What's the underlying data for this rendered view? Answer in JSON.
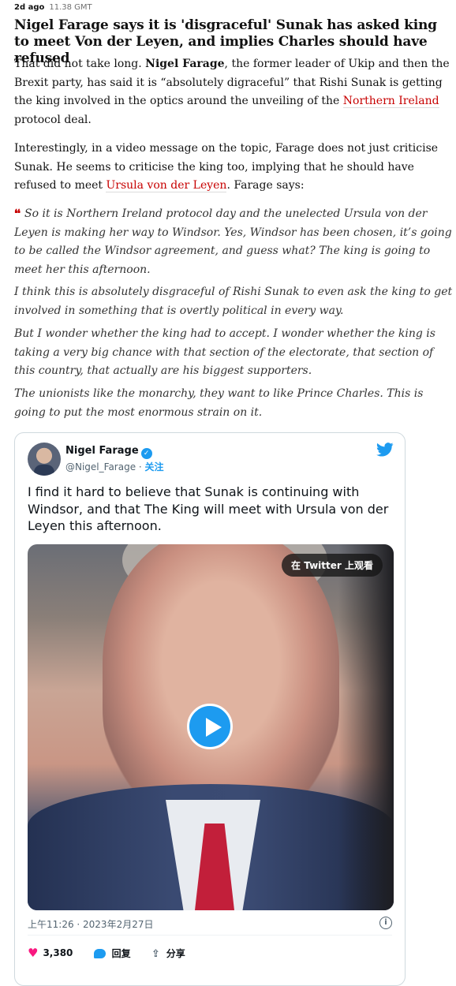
{
  "article": {
    "time_ago": "2d ago",
    "timestamp": "11.38 GMT",
    "headline": "Nigel Farage says it is 'disgraceful' Sunak has asked king to meet Von der Leyen, and implies Charles should have refused",
    "p1": {
      "a": "That did not take long. ",
      "b": "Nigel Farage",
      "c": ", the former leader of Ukip and then the Brexit party, has said it is “absolutely digraceful” that Rishi Sunak is getting the king involved in the optics around the unveiling of the ",
      "link": "Northern Ireland",
      "d": " protocol deal."
    },
    "p2": {
      "a": "Interestingly, in a video message on the topic, Farage does not just criticise Sunak. He seems to criticise the king too, implying that he should have refused to meet ",
      "link": "Ursula von der Leyen",
      "b": ". Farage says:"
    },
    "quote_mark": "❛❛",
    "quotes": [
      "So it is Northern Ireland protocol day and the unelected Ursula von der Leyen is making her way to Windsor. Yes, Windsor has been chosen, it’s going to be called the Windsor agreement, and guess what? The king is going to meet her this afternoon.",
      "I think this is absolutely disgraceful of Rishi Sunak to even ask the king to get involved in something that is overtly political in every way.",
      "But I wonder whether the king had to accept. I wonder whether the king is taking a very big chance with that section of the electorate, that section of this country, that actually are his biggest supporters.",
      "The unionists like the monarchy, they want to like Prince Charles. This is going to put the most enormous strain on it."
    ],
    "link_color": "#c70000"
  },
  "tweet": {
    "name": "Nigel Farage",
    "handle": "@Nigel_Farage",
    "sep": " · ",
    "follow": "关注",
    "text": "I find it hard to believe that Sunak is continuing with Windsor, and that The King will meet with Ursula von der Leyen this afternoon.",
    "watch_label": "在 Twitter 上观看",
    "date": "上午11:26 · 2023年2月27日",
    "likes": "3,380",
    "reply_label": "回复",
    "share_label": "分享",
    "accent": "#1d9bf0",
    "icons": [
      "verified-icon",
      "twitter-bird-icon",
      "play-icon",
      "info-icon",
      "heart-icon",
      "reply-icon",
      "share-icon"
    ]
  }
}
